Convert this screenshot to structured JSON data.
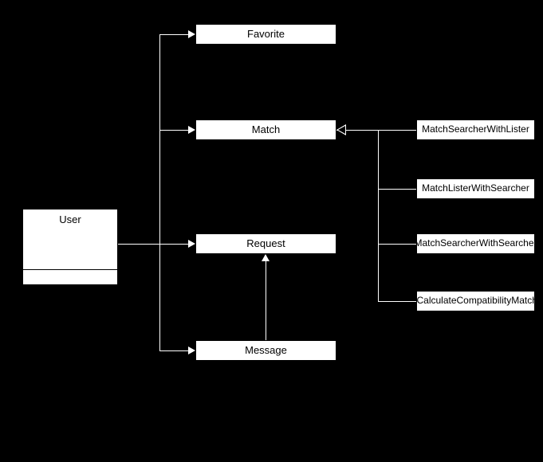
{
  "nodes": {
    "user": "User",
    "favorite": "Favorite",
    "match": "Match",
    "request": "Request",
    "message": "Message",
    "m1": "MatchSearcherWithLister",
    "m2": "MatchListerWithSearcher",
    "m3": "MatchSearcherWithSearcher",
    "m4": ".CalculateCompatibilityMatch"
  }
}
